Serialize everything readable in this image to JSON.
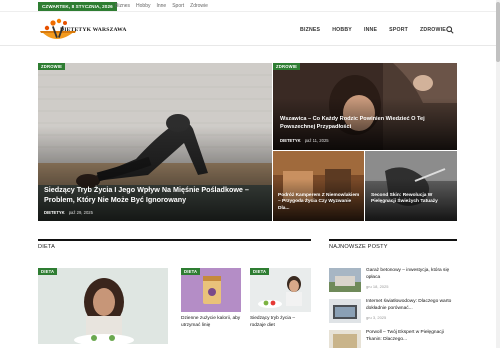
{
  "topbar": {
    "date": "CZWARTEK, 8 STYCZNIA, 2026",
    "links": [
      "Biznes",
      "Hobby",
      "Inne",
      "Sport",
      "Zdrowie"
    ]
  },
  "header": {
    "logo_text": "DIETETYK WARSZAWA",
    "nav": [
      "BIZNES",
      "HOBBY",
      "INNE",
      "SPORT",
      "ZDROWIE"
    ]
  },
  "hero": {
    "main": {
      "tag": "ZDROWIE",
      "title": "Siedzący Tryb Życia I Jego Wpływ Na Mięśnie Pośladkowe – Problem, Który Nie Może Być Ignorowany",
      "author": "DIETETYK",
      "date": "paź 29, 2025"
    },
    "top_right": {
      "tag": "ZDROWIE",
      "title": "Wszawica – Co Każdy Rodzic Powinien Wiedzieć O Tej Powszechnej Przypadłości",
      "author": "DIETETYK",
      "date": "paź 11, 2025"
    },
    "bottom_left": {
      "title": "Podróż Kamperem Z Niemowlakiem – Przygoda Życia Czy Wyzwanie Dla..."
    },
    "bottom_right": {
      "title": "Second Skin: Rewolucja W Pielęgnacji Świeżych Tatuaży"
    }
  },
  "dieta": {
    "heading": "DIETA",
    "main_tag": "DIETA",
    "items": [
      {
        "tag": "DIETA",
        "title": "Dzienne zużycie kalorii, aby utrzymać linię"
      },
      {
        "tag": "DIETA",
        "title": "Siedzący tryb życia – rodzaje diet"
      }
    ]
  },
  "latest": {
    "heading": "NAJNOWSZE POSTY",
    "items": [
      {
        "title": "Garaż betonowy – inwestycja, która się opłaca",
        "date": "gru 18, 2025"
      },
      {
        "title": "Internet światłowodowy: Dlaczego warto dokładnie porównać...",
        "date": "gru 3, 2025"
      },
      {
        "title": "Porwoll – Twój Ekspert w Pielęgnacji Tkanin: Dlaczego...",
        "date": ""
      }
    ]
  }
}
